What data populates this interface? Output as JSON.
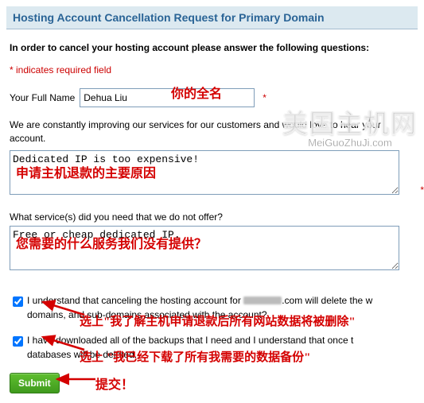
{
  "header": {
    "title": "Hosting Account Cancellation Request for Primary Domain"
  },
  "lead": "In order to cancel your hosting account please answer the following questions:",
  "required_note": "* indicates required field",
  "name": {
    "label": "Your Full Name",
    "value": "Dehua Liu"
  },
  "improve_text": "We are constantly improving our services for our customers and would love to hear your account.",
  "reason_value": "Dedicated IP is too expensive!",
  "service_q": "What service(s) did you need that we do not offer?",
  "service_value": "Free or cheap dedicated IP.",
  "check1_pre": "I understand that canceling the hosting account for ",
  "check1_post": ".com will delete the w",
  "check1_line2": "domains, and sub-domains associated with the account?",
  "check2": "I have downloaded all of the backups that I need and I understand that once t",
  "check2_line2": "databases will be deleted.",
  "submit": "Submit",
  "annotations": {
    "fullname": "你的全名",
    "reason": "申请主机退款的主要原因",
    "service": "您需要的什么服务我们没有提供？",
    "c1": "选上\"我了解主机申请退款后所有网站数据将被删除\"",
    "c2": "选上 \"我已经下载了所有我需要的数据备份\"",
    "submit": "提交！"
  },
  "watermark": {
    "big": "美国主机网",
    "small": "MeiGuoZhuJi.com"
  }
}
